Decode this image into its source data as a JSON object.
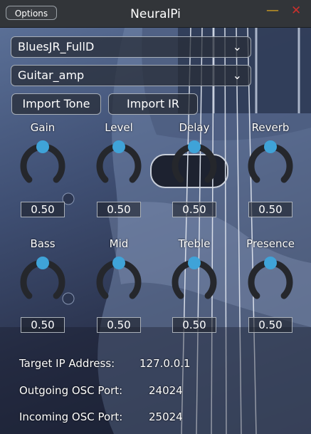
{
  "window": {
    "title": "NeuralPi",
    "options_label": "Options",
    "minimize_glyph": "—",
    "close_glyph": "✕"
  },
  "model_select": {
    "value": "BluesJR_FullD"
  },
  "ir_select": {
    "value": "Guitar_amp"
  },
  "buttons": {
    "import_tone": "Import Tone",
    "import_ir": "Import IR"
  },
  "knobs": [
    {
      "label": "Gain",
      "value": "0.50",
      "level": 0.5
    },
    {
      "label": "Level",
      "value": "0.50",
      "level": 0.5
    },
    {
      "label": "Delay",
      "value": "0.50",
      "level": 0.5
    },
    {
      "label": "Reverb",
      "value": "0.50",
      "level": 0.5
    },
    {
      "label": "Bass",
      "value": "0.50",
      "level": 0.5
    },
    {
      "label": "Mid",
      "value": "0.50",
      "level": 0.5
    },
    {
      "label": "Treble",
      "value": "0.50",
      "level": 0.5
    },
    {
      "label": "Presence",
      "value": "0.50",
      "level": 0.5
    }
  ],
  "network": {
    "ip_label": "Target IP Address:",
    "ip_value": "127.0.0.1",
    "out_label": "Outgoing OSC Port:",
    "out_value": "24024",
    "in_label": "Incoming OSC Port:",
    "in_value": "25024"
  },
  "colors": {
    "knob_track": "#25272c",
    "knob_thumb": "#3fa3d8",
    "accent_min": "#d9a520",
    "accent_close": "#c9302c"
  }
}
